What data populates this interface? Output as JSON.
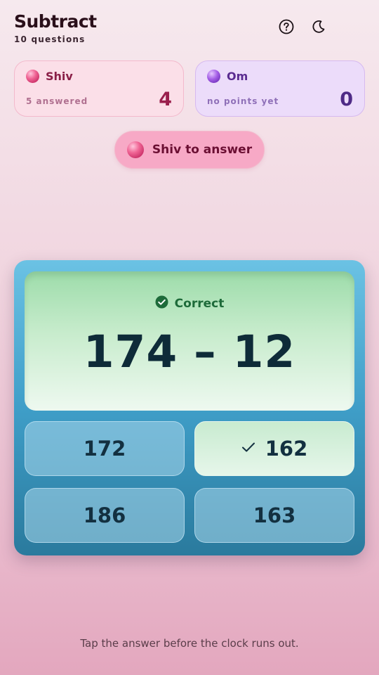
{
  "header": {
    "title": "Subtract",
    "subtitle": "10 questions",
    "icons": [
      "help-icon",
      "dark-mode-moon-icon"
    ]
  },
  "players": [
    {
      "name": "Shiv",
      "status": "5 answered",
      "score": "4",
      "color": "#f06595"
    },
    {
      "name": "Om",
      "status": "no points yet",
      "score": "0",
      "color": "#a45ee6"
    }
  ],
  "turn": {
    "label": "Shiv to answer"
  },
  "question": {
    "result_label": "Correct",
    "text": "174 – 12"
  },
  "answers": [
    {
      "text": "172",
      "state": "default"
    },
    {
      "text": "162",
      "state": "correct"
    },
    {
      "text": "186",
      "state": "default"
    },
    {
      "text": "163",
      "state": "default"
    }
  ],
  "footer": {
    "hint": "Tap the answer before the clock runs out."
  },
  "colors": {
    "correct": "#1e6b3a",
    "board": "#3f9ec8"
  }
}
